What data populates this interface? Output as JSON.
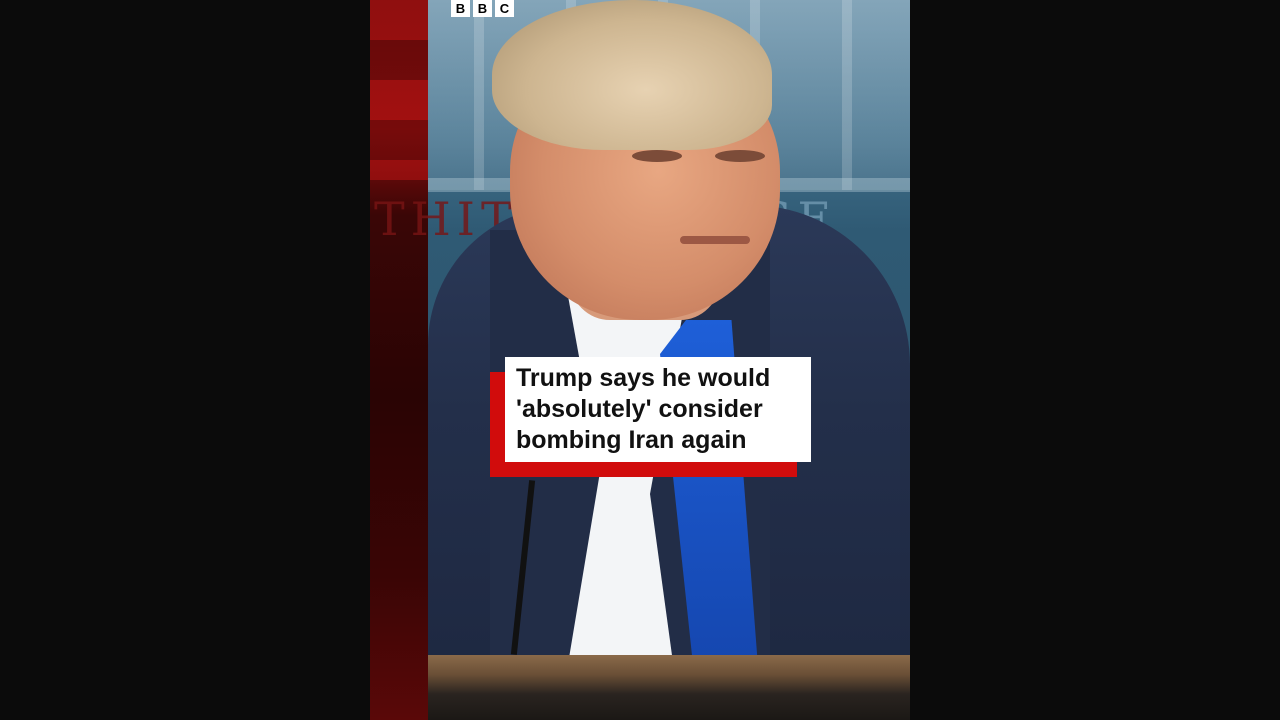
{
  "logo": {
    "letters": [
      "B",
      "B",
      "C"
    ]
  },
  "caption": {
    "lines": [
      "Trump says he would",
      "'absolutely' consider",
      "bombing Iran again"
    ]
  },
  "colors": {
    "caption_accent": "#d10c0c",
    "caption_background": "#ffffff",
    "page_background": "#0b0b0b"
  }
}
